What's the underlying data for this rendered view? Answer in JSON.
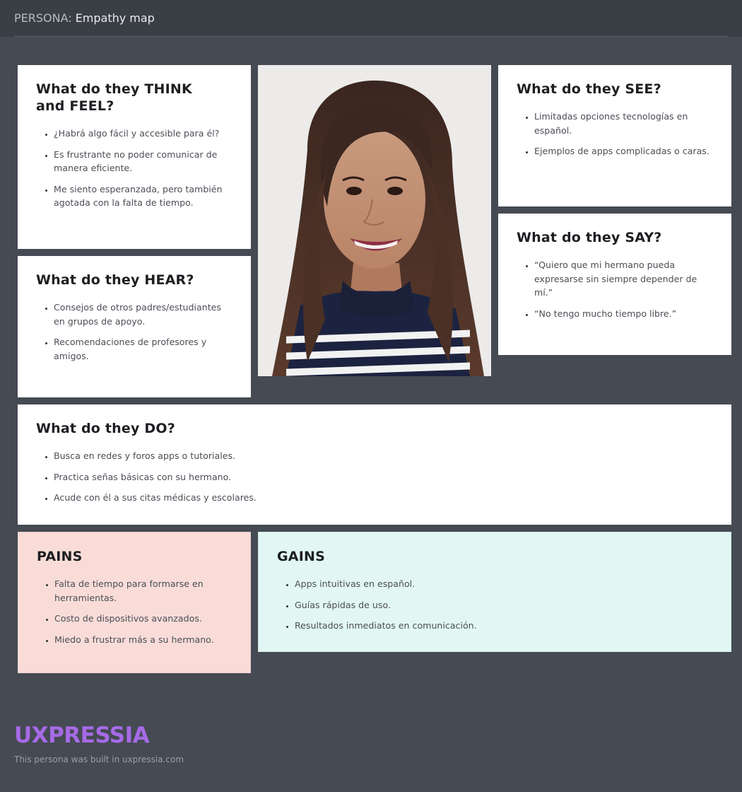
{
  "header": {
    "persona_label": "PERSONA:",
    "title": "Empathy map"
  },
  "think_feel": {
    "heading": "What do they THINK and FEEL?",
    "items": [
      "¿Habrá algo fácil y accesible para él?",
      "Es frustrante no poder comunicar de manera eficiente.",
      "Me siento esperanzada, pero también agotada con la falta de tiempo."
    ]
  },
  "hear": {
    "heading": "What do they HEAR?",
    "items": [
      "Consejos de otros padres/estudiantes en grupos de apoyo.",
      "Recomendaciones de profesores y amigos."
    ]
  },
  "see": {
    "heading": "What do they SEE?",
    "items": [
      "Limitadas opciones tecnologías en español.",
      "Ejemplos de apps complicadas o caras."
    ]
  },
  "say": {
    "heading": "What do they SAY?",
    "items": [
      "“Quiero que mi hermano pueda expresarse sin siempre depender de mí.”",
      "“No tengo mucho tiempo libre.”"
    ]
  },
  "do": {
    "heading": "What do they DO?",
    "items": [
      "Busca en redes y foros apps o tutoriales.",
      "Practica señas básicas con su hermano.",
      "Acude con él a sus citas médicas y escolares."
    ]
  },
  "pains": {
    "heading": "PAINS",
    "color": "#f9dcd8",
    "items": [
      "Falta de tiempo para formarse en herramientas.",
      "Costo de dispositivos avanzados.",
      "Miedo a frustrar más a su hermano."
    ]
  },
  "gains": {
    "heading": "GAINS",
    "color": "#e2f7f3",
    "items": [
      "Apps intuitivas en español.",
      "Guías rápidas de uso.",
      "Resultados inmediatos en comunicación."
    ]
  },
  "footer": {
    "brand": "UXPRESSIA",
    "brand_color": "#a66ae6",
    "note": "This persona was built in uxpressia.com"
  }
}
